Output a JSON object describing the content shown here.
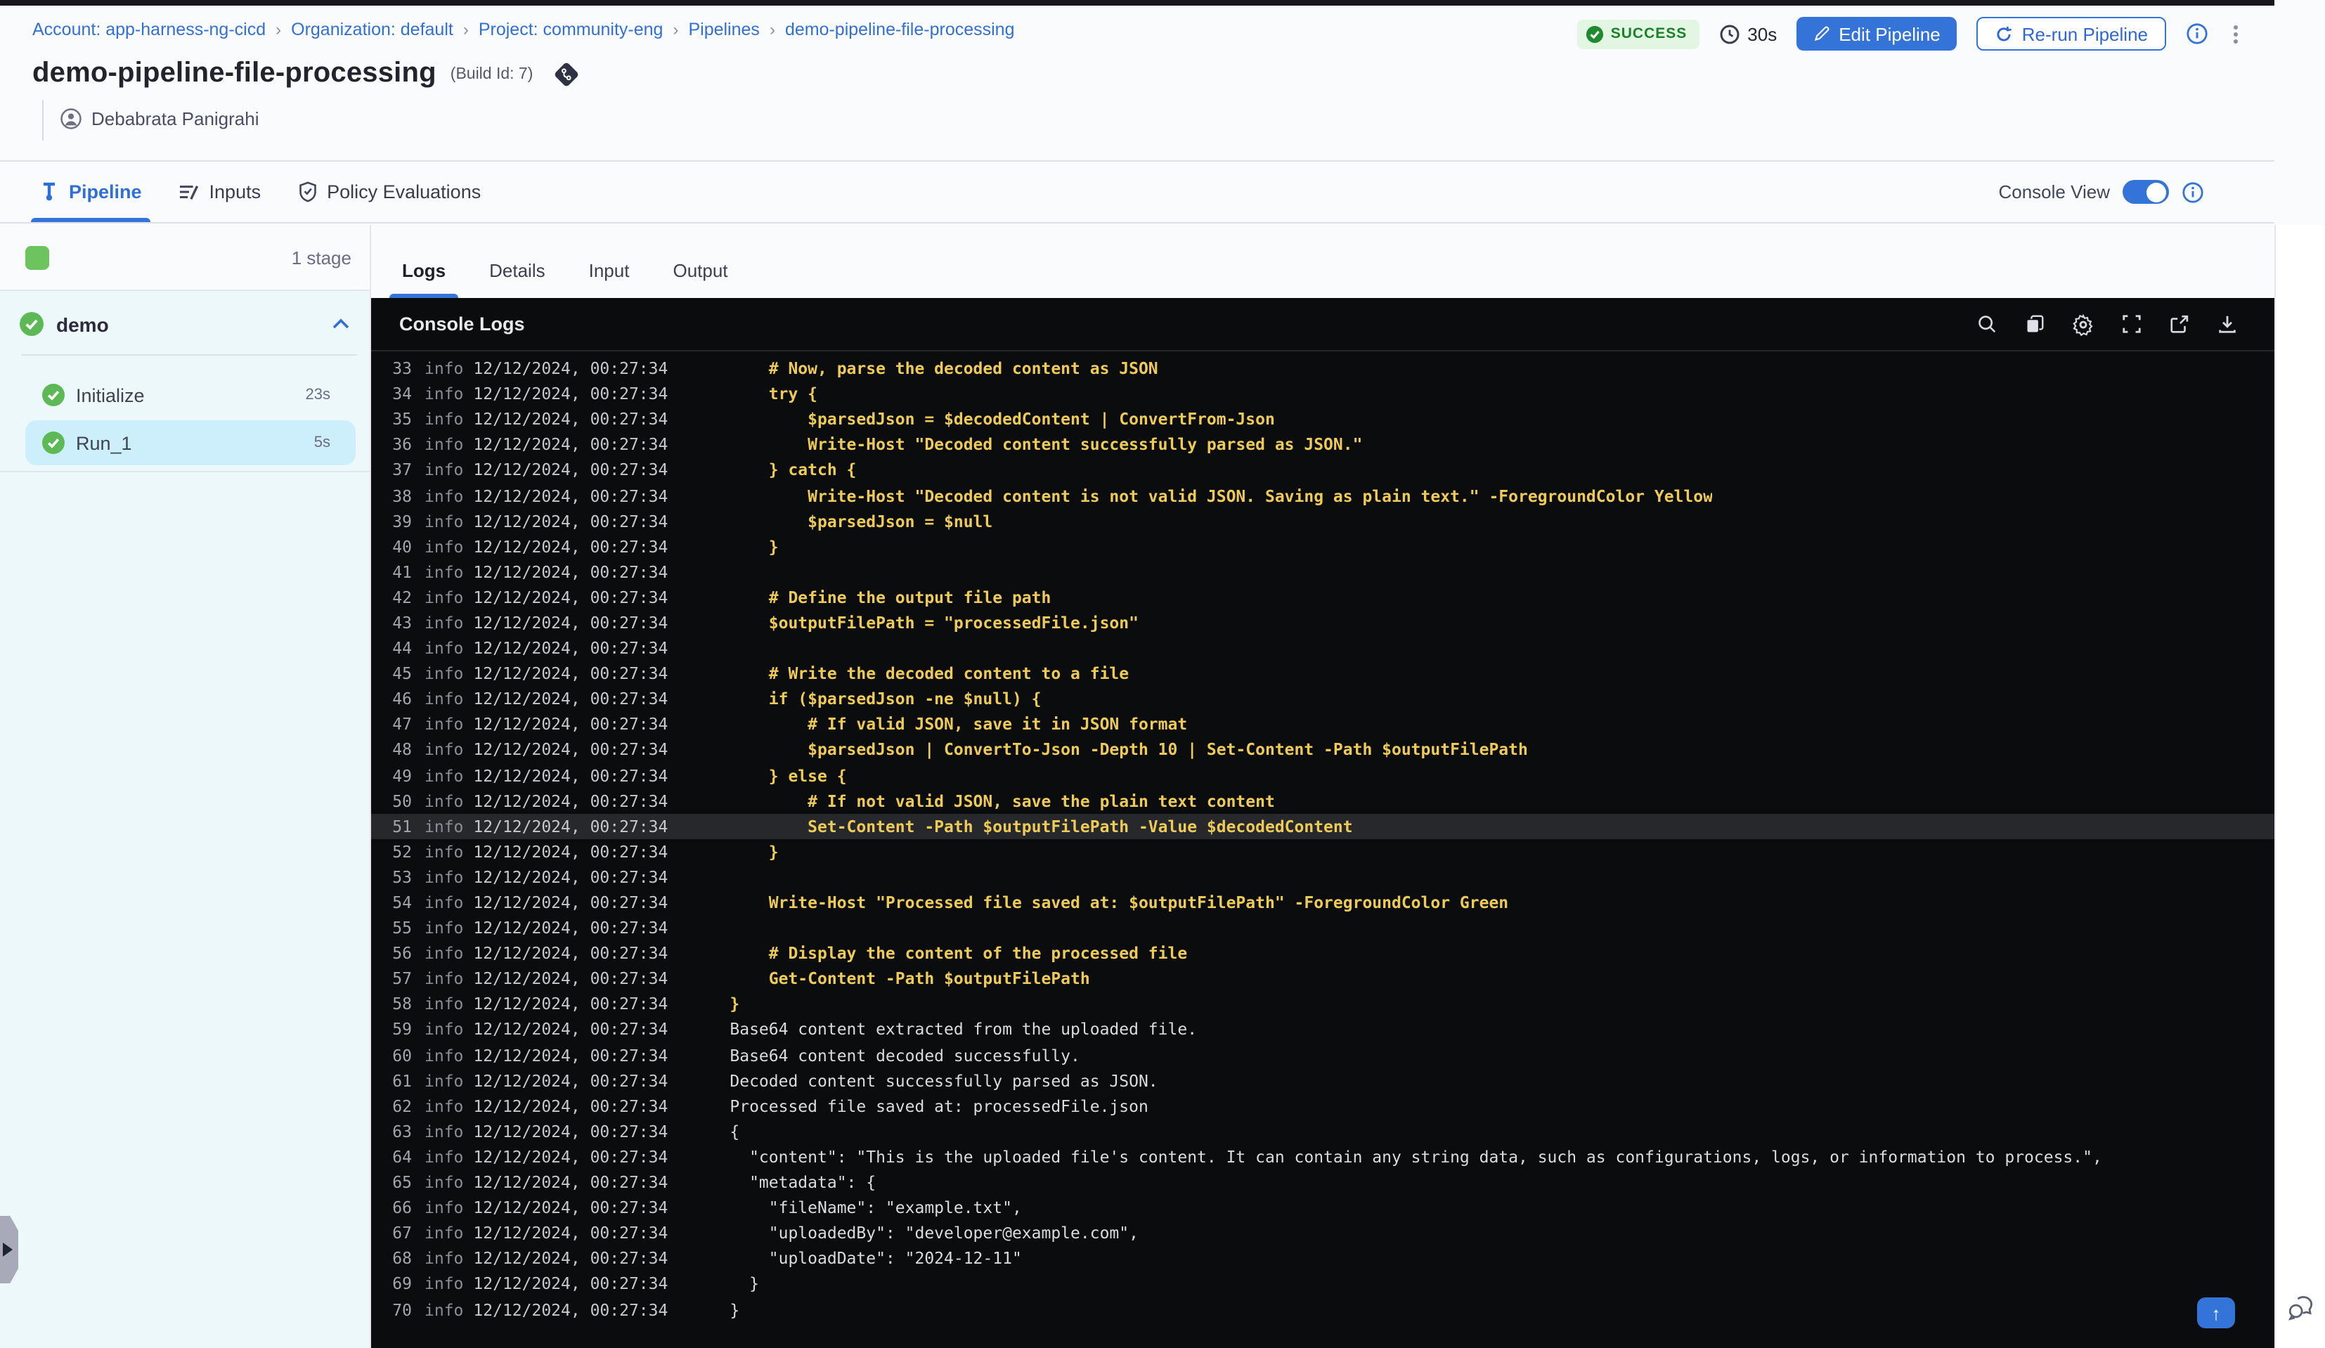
{
  "breadcrumbs": {
    "separator": "›",
    "items": [
      "Account: app-harness-ng-cicd",
      "Organization: default",
      "Project: community-eng",
      "Pipelines",
      "demo-pipeline-file-processing"
    ]
  },
  "header": {
    "title": "demo-pipeline-file-processing",
    "build_id": "(Build Id: 7)",
    "author": "Debabrata Panigrahi",
    "status": "SUCCESS",
    "duration": "30s",
    "edit_button": "Edit Pipeline",
    "rerun_button": "Re-run Pipeline"
  },
  "tabs": {
    "pipeline": "Pipeline",
    "inputs": "Inputs",
    "policy": "Policy Evaluations",
    "console_view_label": "Console View",
    "console_view_on": true
  },
  "sidebar": {
    "stage_count": "1 stage",
    "stage_group": {
      "name": "demo"
    },
    "steps": [
      {
        "label": "Initialize",
        "duration": "23s",
        "selected": false
      },
      {
        "label": "Run_1",
        "duration": "5s",
        "selected": true
      }
    ]
  },
  "console": {
    "header": "Console Logs",
    "toolbar_icons": [
      "search",
      "copy",
      "settings",
      "fullscreen",
      "open-in-new",
      "download"
    ],
    "tabs": [
      {
        "label": "Logs",
        "active": true
      },
      {
        "label": "Details",
        "active": false
      },
      {
        "label": "Input",
        "active": false
      },
      {
        "label": "Output",
        "active": false
      }
    ],
    "rows": [
      {
        "n": "33",
        "level": "info",
        "time": "12/12/2024, 00:27:34",
        "text": "    # Now, parse the decoded content as JSON",
        "color": "y",
        "highlight": false
      },
      {
        "n": "34",
        "level": "info",
        "time": "12/12/2024, 00:27:34",
        "text": "    try {",
        "color": "y",
        "highlight": false
      },
      {
        "n": "35",
        "level": "info",
        "time": "12/12/2024, 00:27:34",
        "text": "        $parsedJson = $decodedContent | ConvertFrom-Json",
        "color": "y",
        "highlight": false
      },
      {
        "n": "36",
        "level": "info",
        "time": "12/12/2024, 00:27:34",
        "text": "        Write-Host \"Decoded content successfully parsed as JSON.\"",
        "color": "y",
        "highlight": false
      },
      {
        "n": "37",
        "level": "info",
        "time": "12/12/2024, 00:27:34",
        "text": "    } catch {",
        "color": "y",
        "highlight": false
      },
      {
        "n": "38",
        "level": "info",
        "time": "12/12/2024, 00:27:34",
        "text": "        Write-Host \"Decoded content is not valid JSON. Saving as plain text.\" -ForegroundColor Yellow",
        "color": "y",
        "highlight": false
      },
      {
        "n": "39",
        "level": "info",
        "time": "12/12/2024, 00:27:34",
        "text": "        $parsedJson = $null",
        "color": "y",
        "highlight": false
      },
      {
        "n": "40",
        "level": "info",
        "time": "12/12/2024, 00:27:34",
        "text": "    }",
        "color": "y",
        "highlight": false
      },
      {
        "n": "41",
        "level": "info",
        "time": "12/12/2024, 00:27:34",
        "text": "",
        "color": "y",
        "highlight": false
      },
      {
        "n": "42",
        "level": "info",
        "time": "12/12/2024, 00:27:34",
        "text": "    # Define the output file path",
        "color": "y",
        "highlight": false
      },
      {
        "n": "43",
        "level": "info",
        "time": "12/12/2024, 00:27:34",
        "text": "    $outputFilePath = \"processedFile.json\"",
        "color": "y",
        "highlight": false
      },
      {
        "n": "44",
        "level": "info",
        "time": "12/12/2024, 00:27:34",
        "text": "",
        "color": "y",
        "highlight": false
      },
      {
        "n": "45",
        "level": "info",
        "time": "12/12/2024, 00:27:34",
        "text": "    # Write the decoded content to a file",
        "color": "y",
        "highlight": false
      },
      {
        "n": "46",
        "level": "info",
        "time": "12/12/2024, 00:27:34",
        "text": "    if ($parsedJson -ne $null) {",
        "color": "y",
        "highlight": false
      },
      {
        "n": "47",
        "level": "info",
        "time": "12/12/2024, 00:27:34",
        "text": "        # If valid JSON, save it in JSON format",
        "color": "y",
        "highlight": false
      },
      {
        "n": "48",
        "level": "info",
        "time": "12/12/2024, 00:27:34",
        "text": "        $parsedJson | ConvertTo-Json -Depth 10 | Set-Content -Path $outputFilePath",
        "color": "y",
        "highlight": false
      },
      {
        "n": "49",
        "level": "info",
        "time": "12/12/2024, 00:27:34",
        "text": "    } else {",
        "color": "y",
        "highlight": false
      },
      {
        "n": "50",
        "level": "info",
        "time": "12/12/2024, 00:27:34",
        "text": "        # If not valid JSON, save the plain text content",
        "color": "y",
        "highlight": false
      },
      {
        "n": "51",
        "level": "info",
        "time": "12/12/2024, 00:27:34",
        "text": "        Set-Content -Path $outputFilePath -Value $decodedContent",
        "color": "y",
        "highlight": true
      },
      {
        "n": "52",
        "level": "info",
        "time": "12/12/2024, 00:27:34",
        "text": "    }",
        "color": "y",
        "highlight": false
      },
      {
        "n": "53",
        "level": "info",
        "time": "12/12/2024, 00:27:34",
        "text": "",
        "color": "y",
        "highlight": false
      },
      {
        "n": "54",
        "level": "info",
        "time": "12/12/2024, 00:27:34",
        "text": "    Write-Host \"Processed file saved at: $outputFilePath\" -ForegroundColor Green",
        "color": "y",
        "highlight": false
      },
      {
        "n": "55",
        "level": "info",
        "time": "12/12/2024, 00:27:34",
        "text": "",
        "color": "y",
        "highlight": false
      },
      {
        "n": "56",
        "level": "info",
        "time": "12/12/2024, 00:27:34",
        "text": "    # Display the content of the processed file",
        "color": "y",
        "highlight": false
      },
      {
        "n": "57",
        "level": "info",
        "time": "12/12/2024, 00:27:34",
        "text": "    Get-Content -Path $outputFilePath",
        "color": "y",
        "highlight": false
      },
      {
        "n": "58",
        "level": "info",
        "time": "12/12/2024, 00:27:34",
        "text": "}",
        "color": "y",
        "highlight": false
      },
      {
        "n": "59",
        "level": "info",
        "time": "12/12/2024, 00:27:34",
        "text": "Base64 content extracted from the uploaded file.",
        "color": "w",
        "highlight": false
      },
      {
        "n": "60",
        "level": "info",
        "time": "12/12/2024, 00:27:34",
        "text": "Base64 content decoded successfully.",
        "color": "w",
        "highlight": false
      },
      {
        "n": "61",
        "level": "info",
        "time": "12/12/2024, 00:27:34",
        "text": "Decoded content successfully parsed as JSON.",
        "color": "w",
        "highlight": false
      },
      {
        "n": "62",
        "level": "info",
        "time": "12/12/2024, 00:27:34",
        "text": "Processed file saved at: processedFile.json",
        "color": "w",
        "highlight": false
      },
      {
        "n": "63",
        "level": "info",
        "time": "12/12/2024, 00:27:34",
        "text": "{",
        "color": "w",
        "highlight": false
      },
      {
        "n": "64",
        "level": "info",
        "time": "12/12/2024, 00:27:34",
        "text": "  \"content\": \"This is the uploaded file's content. It can contain any string data, such as configurations, logs, or information to process.\",",
        "color": "w",
        "highlight": false
      },
      {
        "n": "65",
        "level": "info",
        "time": "12/12/2024, 00:27:34",
        "text": "  \"metadata\": {",
        "color": "w",
        "highlight": false
      },
      {
        "n": "66",
        "level": "info",
        "time": "12/12/2024, 00:27:34",
        "text": "    \"fileName\": \"example.txt\",",
        "color": "w",
        "highlight": false
      },
      {
        "n": "67",
        "level": "info",
        "time": "12/12/2024, 00:27:34",
        "text": "    \"uploadedBy\": \"developer@example.com\",",
        "color": "w",
        "highlight": false
      },
      {
        "n": "68",
        "level": "info",
        "time": "12/12/2024, 00:27:34",
        "text": "    \"uploadDate\": \"2024-12-11\"",
        "color": "w",
        "highlight": false
      },
      {
        "n": "69",
        "level": "info",
        "time": "12/12/2024, 00:27:34",
        "text": "  }",
        "color": "w",
        "highlight": false
      },
      {
        "n": "70",
        "level": "info",
        "time": "12/12/2024, 00:27:34",
        "text": "}",
        "color": "w",
        "highlight": false
      }
    ]
  },
  "misc": {
    "scroll_top_icon": "↑"
  },
  "colors": {
    "accent_blue": "#3474d8",
    "success_green_text": "#1b8229",
    "success_green_bg": "#e2f6e3",
    "stage_green": "#6dc35e",
    "log_yellow": "#eecb57",
    "selected_step_bg": "#cdeefb",
    "console_bg": "#0b0c0e"
  }
}
